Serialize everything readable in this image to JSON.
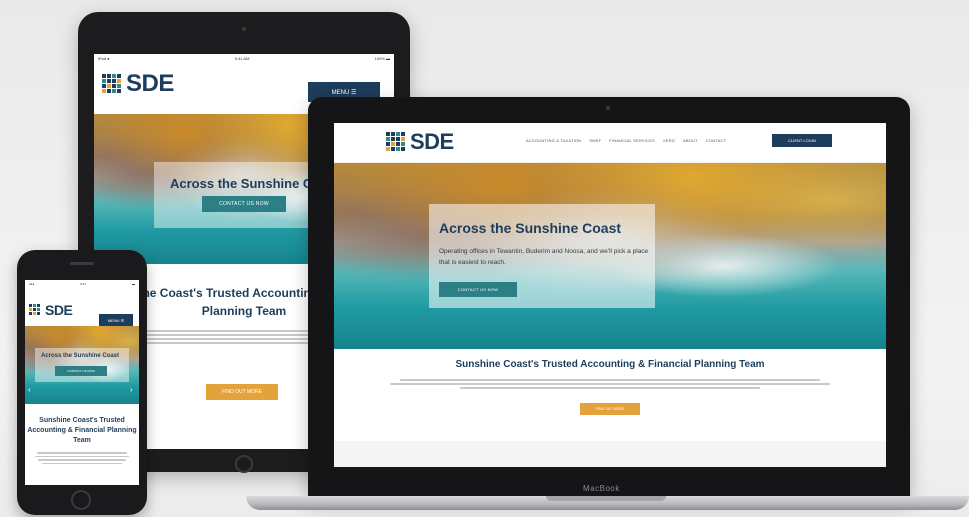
{
  "site": {
    "logo_text": "SDE",
    "logo_colors": {
      "navy": "#1e3d5c",
      "teal": "#2d8a8a",
      "gold": "#e3a23b"
    },
    "menu_label": "MENU ☰",
    "hero_title": "Across the Sunshine Coast",
    "hero_description": "Operating offices in Tewantin, Buderim and Noosa, and we'll pick a place that is easiest to reach.",
    "hero_button": "CONTACT US NOW",
    "section_heading": "Sunshine Coast's Trusted Accounting & Financial Planning Team",
    "more_button": "FIND OUT MORE",
    "client_login": "CLIENT LOGIN",
    "nav_items": [
      "ACCOUNTING & TAXATION",
      "SMSF",
      "FINANCIAL SERVICES",
      "XERO",
      "ABOUT",
      "CONTACT"
    ]
  },
  "tablet": {
    "status_left": "iPad ●",
    "status_time": "9:41 AM",
    "status_right": "100% ▬"
  },
  "phone": {
    "status_left": "●●●",
    "status_time": "9:41",
    "status_right": "▬"
  },
  "laptop": {
    "brand": "MacBook"
  }
}
